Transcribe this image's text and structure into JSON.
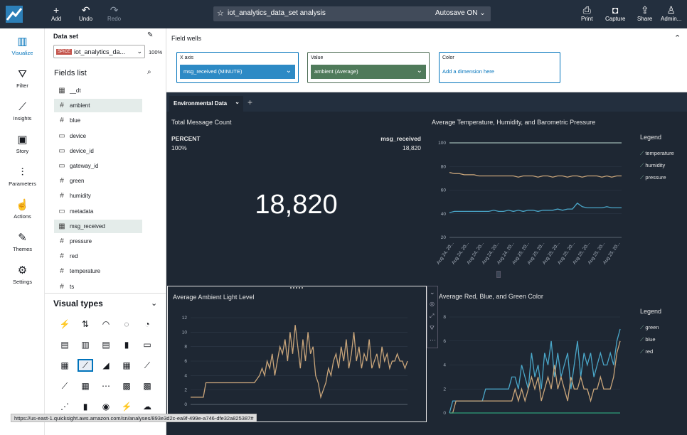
{
  "topbar": {
    "add": "Add",
    "undo": "Undo",
    "redo": "Redo",
    "title": "iot_analytics_data_set analysis",
    "autosave": "Autosave ON",
    "print": "Print",
    "capture": "Capture",
    "share": "Share",
    "admin": "Admin..."
  },
  "rail": {
    "items": [
      "Visualize",
      "Filter",
      "Insights",
      "Story",
      "Parameters",
      "Actions",
      "Themes",
      "Settings"
    ]
  },
  "dataset": {
    "label": "Data set",
    "badge": "SPICE",
    "name": "iot_analytics_da...",
    "pct": "100%"
  },
  "fields_title": "Fields list",
  "fields": [
    {
      "icon": "date",
      "name": "__dt"
    },
    {
      "icon": "num",
      "name": "ambient"
    },
    {
      "icon": "num",
      "name": "blue"
    },
    {
      "icon": "str",
      "name": "device"
    },
    {
      "icon": "str",
      "name": "device_id"
    },
    {
      "icon": "str",
      "name": "gateway_id"
    },
    {
      "icon": "num",
      "name": "green"
    },
    {
      "icon": "num",
      "name": "humidity"
    },
    {
      "icon": "str",
      "name": "metadata"
    },
    {
      "icon": "date",
      "name": "msg_received"
    },
    {
      "icon": "num",
      "name": "pressure"
    },
    {
      "icon": "num",
      "name": "red"
    },
    {
      "icon": "num",
      "name": "temperature"
    },
    {
      "icon": "num",
      "name": "ts"
    }
  ],
  "visual_types_title": "Visual types",
  "wells": {
    "title": "Field wells",
    "x_label": "X axis",
    "x_value": "msg_received (MINUTE)",
    "v_label": "Value",
    "v_value": "ambient (Average)",
    "c_label": "Color",
    "c_placeholder": "Add a dimension here"
  },
  "sheet_tab": "Environmental Data",
  "kpi": {
    "title": "Total Message Count",
    "left_label": "PERCENT",
    "left_value": "100%",
    "right_label": "msg_received",
    "right_value": "18,820",
    "big": "18,820"
  },
  "colors": {
    "temperature": "#c9a57a",
    "humidity": "#4aa7c9",
    "pressure": "#9ab5b0",
    "ambient": "#c9a57a",
    "green": "#2e9e7a",
    "blue": "#4aa7c9",
    "red": "#c9a57a"
  },
  "chart_data": [
    {
      "type": "line",
      "title": "Average Temperature, Humidity, and Barometric Pressure",
      "ylim": [
        20,
        100
      ],
      "yticks": [
        20,
        40,
        60,
        80,
        100
      ],
      "xticks": [
        "Aug 24, 20...",
        "Aug 24, 20...",
        "Aug 24, 20...",
        "Aug 24, 20...",
        "Aug 24, 20...",
        "Aug 25, 20...",
        "Aug 25, 20...",
        "Aug 25, 20...",
        "Aug 25, 20...",
        "Aug 25, 20...",
        "Aug 25, 20...",
        "Aug 25, 20..."
      ],
      "legend_title": "Legend",
      "legend": [
        "temperature",
        "humidity",
        "pressure"
      ],
      "series": [
        {
          "name": "temperature",
          "values": [
            75,
            74,
            74,
            73,
            73,
            73,
            72,
            72,
            72,
            72,
            72,
            72,
            72,
            72,
            71,
            72,
            72,
            72,
            71,
            72,
            72,
            71,
            72,
            72,
            71,
            72,
            72,
            71,
            72,
            72,
            72,
            71,
            72,
            71,
            72,
            72
          ]
        },
        {
          "name": "humidity",
          "values": [
            41,
            42,
            42,
            42,
            42,
            42,
            42,
            42,
            42,
            43,
            42,
            42,
            43,
            42,
            43,
            42,
            43,
            43,
            42,
            43,
            43,
            43,
            44,
            43,
            44,
            44,
            49,
            46,
            45,
            45,
            45,
            45,
            46,
            45,
            45,
            45
          ]
        },
        {
          "name": "pressure",
          "values": [
            100,
            100,
            100,
            100,
            100,
            100,
            100,
            100,
            100,
            100,
            100,
            100,
            100,
            100,
            100,
            100,
            100,
            100,
            100,
            100,
            100,
            100,
            100,
            100,
            100,
            100,
            100,
            100,
            100,
            100,
            100,
            100,
            100,
            100,
            100,
            100
          ]
        }
      ]
    },
    {
      "type": "line",
      "title": "Average Ambient Light Level",
      "ylim": [
        0,
        12
      ],
      "yticks": [
        0,
        2,
        4,
        6,
        8,
        10,
        12
      ],
      "series": [
        {
          "name": "ambient",
          "values": [
            1,
            1,
            1,
            1,
            1,
            1,
            3,
            3,
            3,
            3,
            3,
            3,
            3,
            3,
            3,
            3,
            3,
            3,
            3,
            3,
            3,
            3,
            3,
            3,
            3,
            3,
            3.5,
            4,
            5,
            4,
            6,
            5,
            7,
            4,
            6,
            8,
            7,
            9,
            6,
            10,
            7,
            11,
            8,
            5,
            9,
            6,
            10,
            7,
            8,
            4,
            3,
            1,
            2,
            3,
            5,
            4,
            6,
            7,
            5,
            8,
            6,
            9,
            5,
            7,
            10,
            6,
            8,
            5,
            7,
            6,
            9,
            5,
            6,
            7,
            5,
            8,
            6,
            7,
            5,
            6,
            6,
            7,
            6,
            6,
            5,
            6
          ]
        }
      ]
    },
    {
      "type": "line",
      "title": "Average Red, Blue, and Green Color",
      "ylim": [
        0,
        8
      ],
      "yticks": [
        0,
        2,
        4,
        6,
        8
      ],
      "legend_title": "Legend",
      "legend": [
        "green",
        "blue",
        "red"
      ],
      "series": [
        {
          "name": "blue",
          "values": [
            0,
            1,
            1,
            1,
            1,
            1,
            1,
            1,
            1,
            1,
            1,
            2,
            2,
            2,
            2,
            2,
            2,
            2,
            2,
            3,
            3,
            2,
            4,
            3,
            2,
            5,
            3,
            4,
            2,
            5,
            4,
            6,
            3,
            5,
            3,
            4,
            5,
            2,
            4,
            6,
            3,
            5,
            4,
            5,
            3,
            4,
            5,
            4,
            4,
            5,
            4,
            6,
            7
          ]
        },
        {
          "name": "red",
          "values": [
            0,
            0,
            1,
            1,
            1,
            1,
            1,
            1,
            1,
            1,
            1,
            1,
            1,
            1,
            1,
            1,
            1,
            1,
            1,
            1,
            2,
            1,
            2,
            1,
            2,
            3,
            2,
            3,
            1,
            2,
            3,
            2,
            4,
            2,
            3,
            2,
            1,
            3,
            2,
            2,
            3,
            2,
            2,
            1,
            2,
            2,
            3,
            2,
            2,
            2,
            3,
            5,
            6
          ]
        },
        {
          "name": "green",
          "values": [
            0,
            0,
            0,
            0,
            0,
            0,
            0,
            0,
            0,
            0,
            0,
            0,
            0,
            0,
            0,
            0,
            0,
            0,
            0,
            0,
            0,
            0,
            0,
            0,
            0,
            0,
            0,
            0,
            0,
            0,
            0,
            0,
            0,
            0,
            0,
            0,
            0,
            0,
            0,
            0,
            0,
            0,
            0,
            0,
            0,
            0,
            0,
            0,
            0,
            0,
            0,
            0,
            0
          ]
        }
      ]
    }
  ],
  "status_url": "https://us-east-1.quicksight.aws.amazon.com/sn/analyses/893e3d2c-ea9f-499e-a746-dfe32a825387#"
}
